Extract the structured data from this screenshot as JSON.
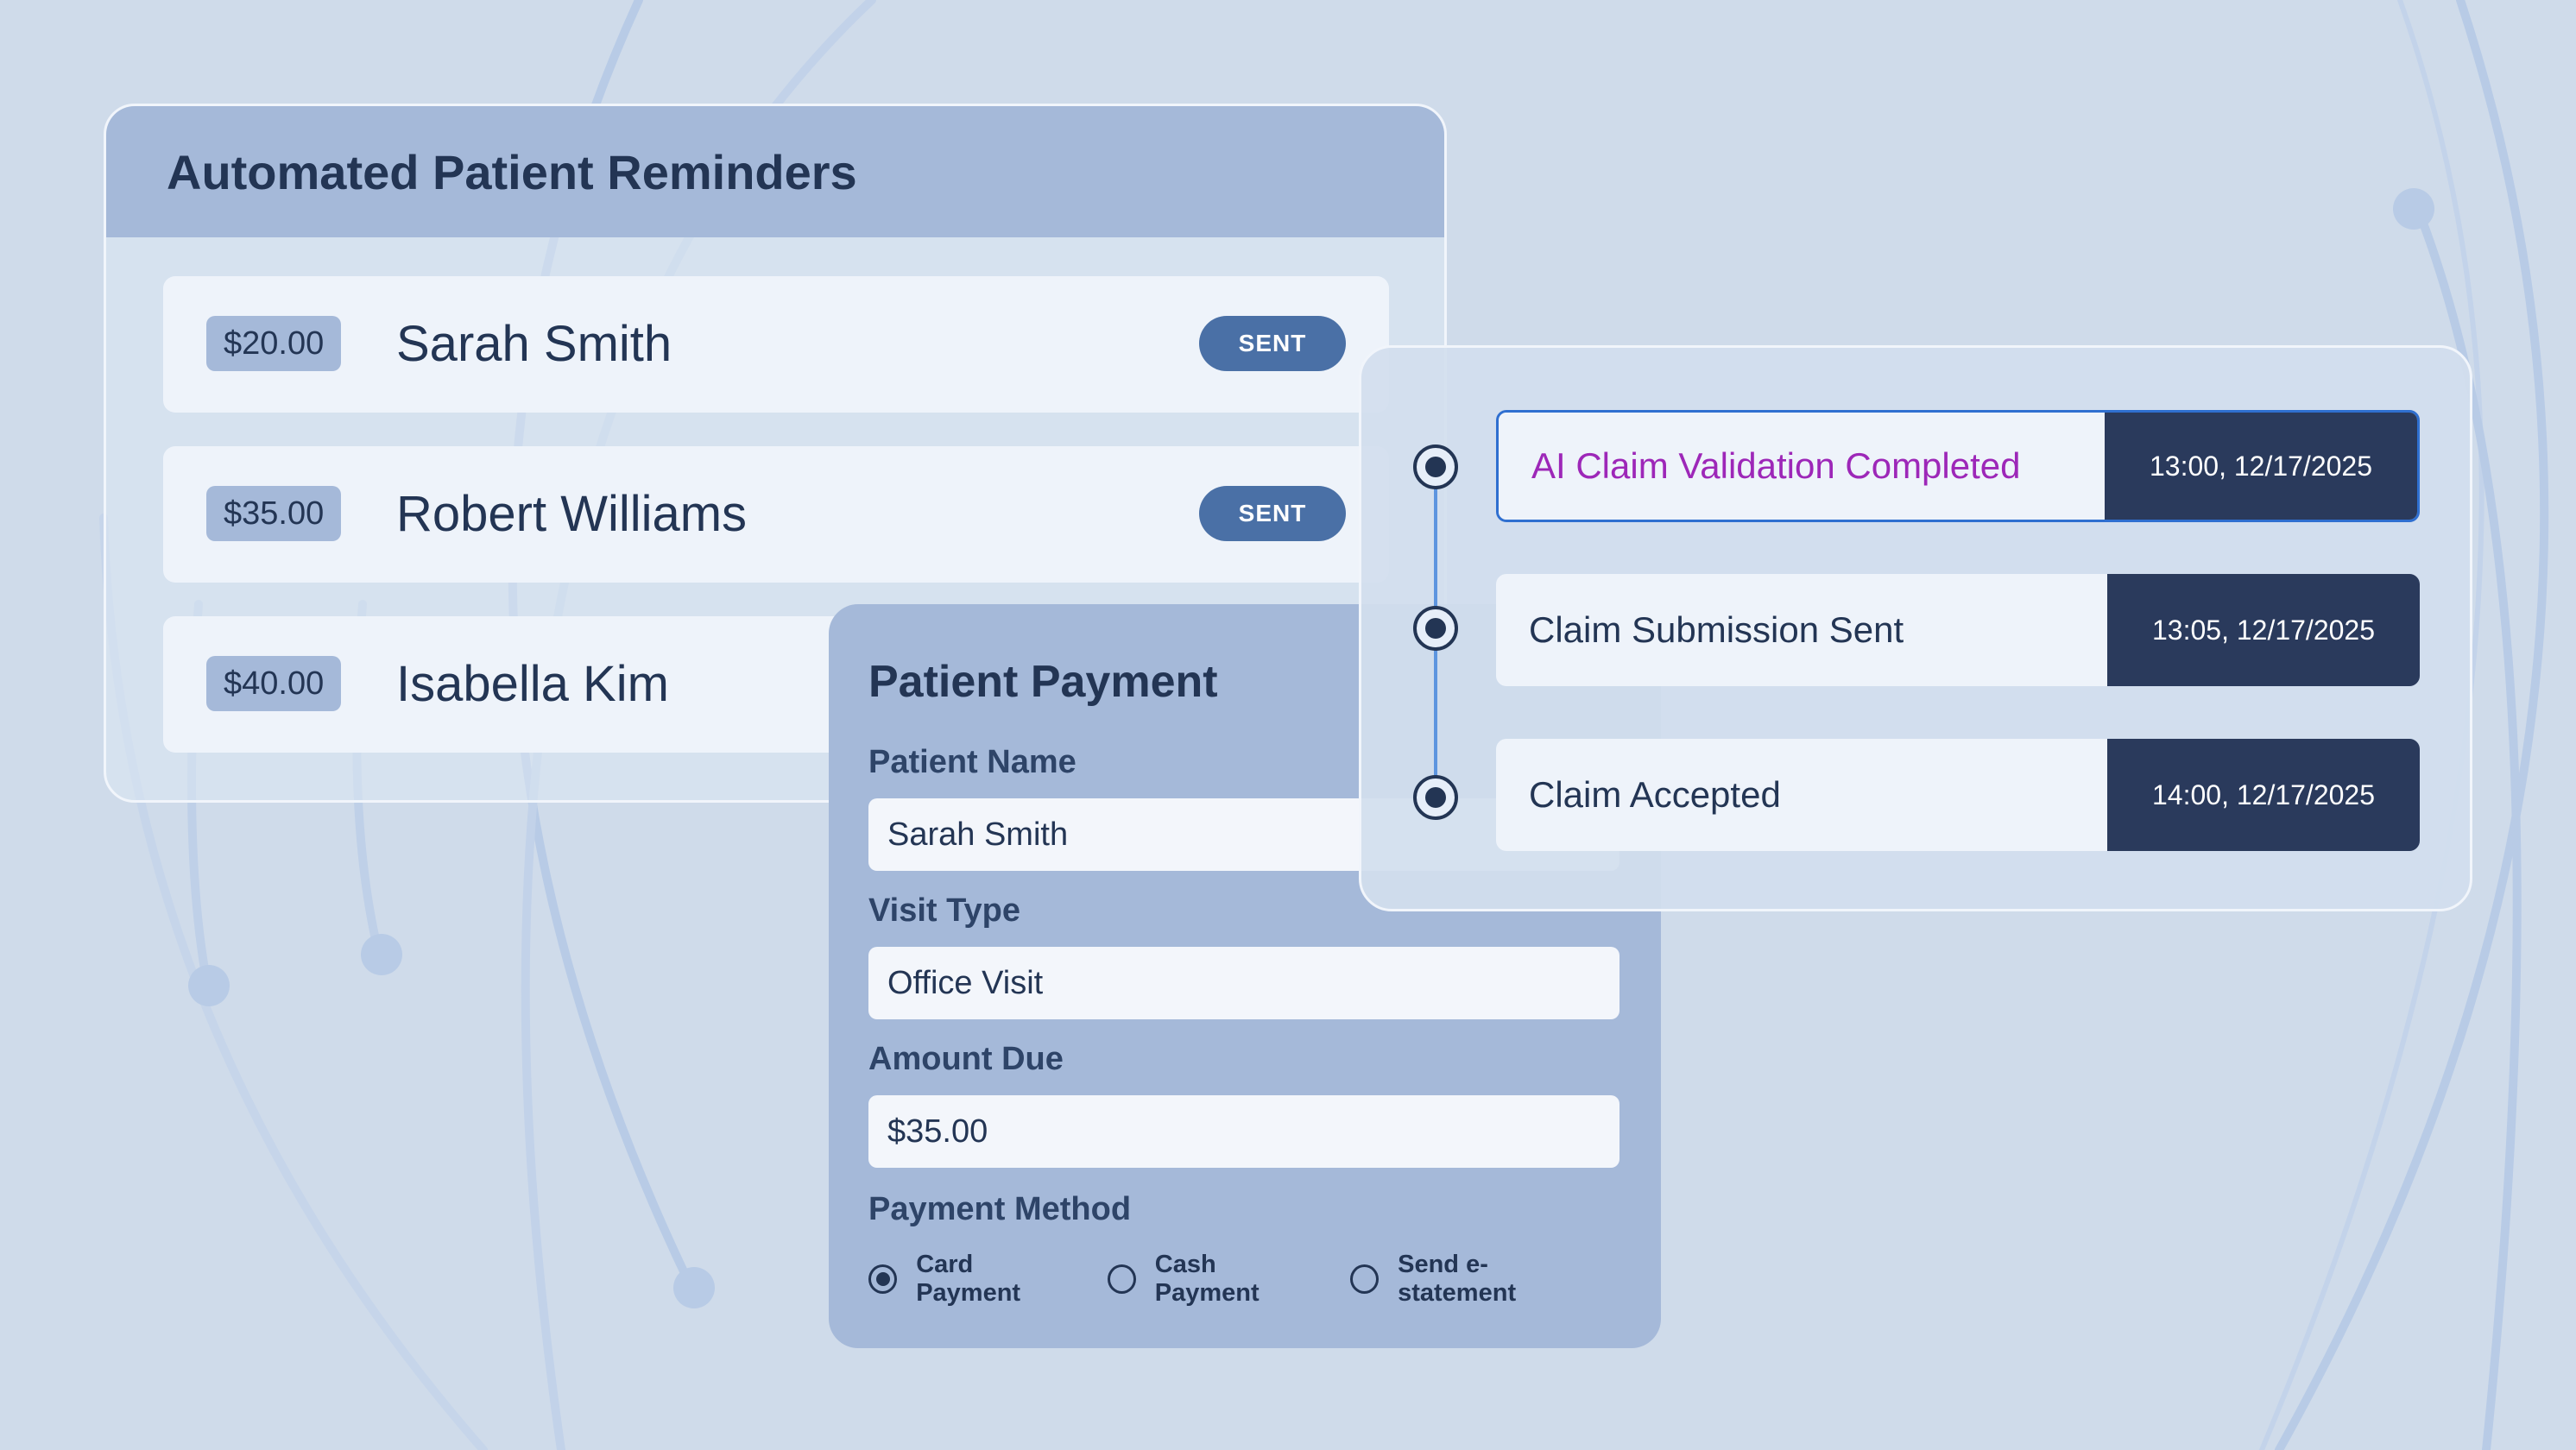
{
  "reminders": {
    "title": "Automated Patient Reminders",
    "items": [
      {
        "amount": "$20.00",
        "name": "Sarah Smith",
        "status": "SENT"
      },
      {
        "amount": "$35.00",
        "name": "Robert Williams",
        "status": "SENT"
      },
      {
        "amount": "$40.00",
        "name": "Isabella Kim",
        "status": ""
      }
    ]
  },
  "payment": {
    "title": "Patient Payment",
    "patient_name_label": "Patient Name",
    "patient_name_value": "Sarah Smith",
    "visit_type_label": "Visit Type",
    "visit_type_value": "Office Visit",
    "amount_due_label": "Amount Due",
    "amount_due_value": "$35.00",
    "payment_method_label": "Payment Method",
    "methods": [
      {
        "label": "Card Payment",
        "selected": true
      },
      {
        "label": "Cash Payment",
        "selected": false
      },
      {
        "label": "Send e-statement",
        "selected": false
      }
    ]
  },
  "timeline": {
    "events": [
      {
        "label": "AI Claim Validation Completed",
        "time": "13:00, 12/17/2025",
        "highlight": true
      },
      {
        "label": "Claim Submission Sent",
        "time": "13:05, 12/17/2025",
        "highlight": false
      },
      {
        "label": "Claim Accepted",
        "time": "14:00, 12/17/2025",
        "highlight": false
      }
    ]
  },
  "colors": {
    "background": "#cfdbea",
    "card_header": "#a5b9d9",
    "accent": "#4a70a6",
    "dark": "#233554",
    "highlight_text": "#9d27b8",
    "timeline_line": "#5d95df"
  }
}
